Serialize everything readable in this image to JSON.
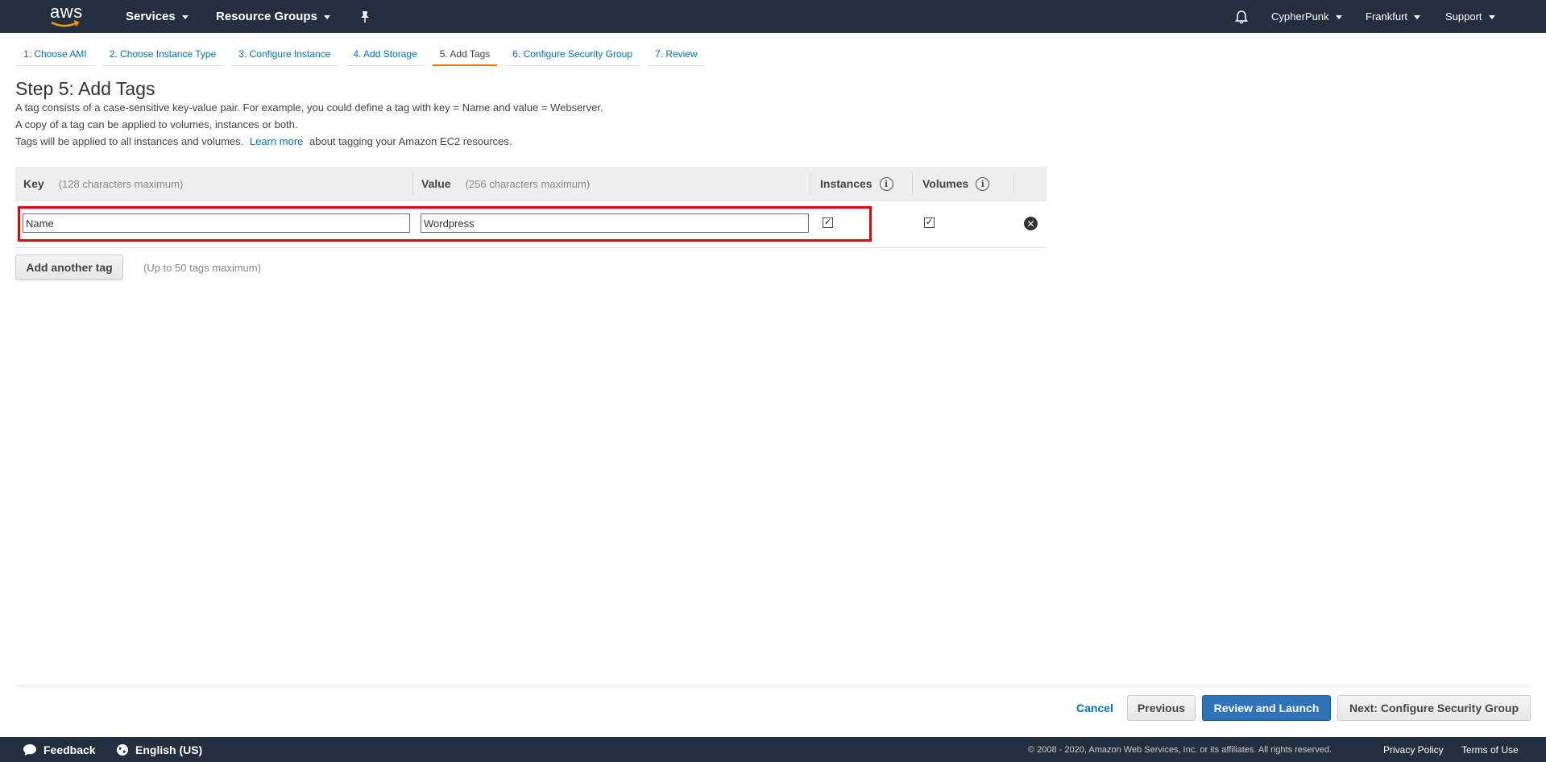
{
  "topnav": {
    "logo_text": "aws",
    "services_label": "Services",
    "resource_groups_label": "Resource Groups",
    "user_label": "CypherPunk",
    "region_label": "Frankfurt",
    "support_label": "Support"
  },
  "wizard": {
    "steps": [
      {
        "label": "1. Choose AMI"
      },
      {
        "label": "2. Choose Instance Type"
      },
      {
        "label": "3. Configure Instance"
      },
      {
        "label": "4. Add Storage"
      },
      {
        "label": "5. Add Tags"
      },
      {
        "label": "6. Configure Security Group"
      },
      {
        "label": "7. Review"
      }
    ],
    "active_step": 4
  },
  "page": {
    "title": "Step 5: Add Tags",
    "desc_line1": "A tag consists of a case-sensitive key-value pair. For example, you could define a tag with key = Name and value = Webserver.",
    "desc_line2": "A copy of a tag can be applied to volumes, instances or both.",
    "desc_line3_pre": "Tags will be applied to all instances and volumes.",
    "learn_more": "Learn more",
    "desc_line3_post": "about tagging your Amazon EC2 resources."
  },
  "table": {
    "headers": {
      "key": "Key",
      "key_hint": "(128 characters maximum)",
      "value": "Value",
      "value_hint": "(256 characters maximum)",
      "instances": "Instances",
      "volumes": "Volumes"
    },
    "rows": [
      {
        "key": "Name",
        "value": "Wordpress",
        "instances": true,
        "volumes": true
      }
    ]
  },
  "add_tag": {
    "button_label": "Add another tag",
    "note": "(Up to 50 tags maximum)"
  },
  "actions": {
    "cancel": "Cancel",
    "previous": "Previous",
    "review_launch": "Review and Launch",
    "next": "Next: Configure Security Group"
  },
  "footer": {
    "feedback": "Feedback",
    "language": "English (US)",
    "copyright": "© 2008 - 2020, Amazon Web Services, Inc. or its affiliates. All rights reserved.",
    "privacy": "Privacy Policy",
    "terms": "Terms of Use"
  },
  "colors": {
    "nav_bg": "#232f3e",
    "link": "#0073bb",
    "active_step": "#ec7211",
    "primary_button": "#2e73b8",
    "highlight": "#e3000f"
  },
  "icons": [
    "aws-logo",
    "caret-down-icon",
    "pin-icon",
    "bell-icon",
    "info-icon",
    "checkbox-checked-icon",
    "remove-circle-icon",
    "speech-bubble-icon",
    "globe-icon"
  ]
}
